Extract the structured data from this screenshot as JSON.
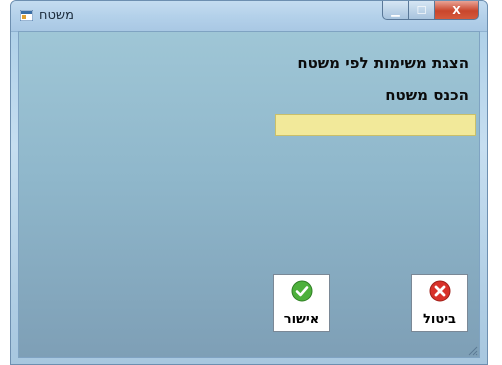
{
  "window": {
    "title": "משטח",
    "caption": {
      "minimize_glyph": "▁",
      "maximize_glyph": "☐",
      "close_glyph": "X"
    }
  },
  "form": {
    "heading": "הצגת משימות לפי משטח",
    "prompt": "הכנס משטח",
    "input_value": ""
  },
  "buttons": {
    "ok_label": "אישור",
    "cancel_label": "ביטול"
  },
  "icons": {
    "app": "form-icon",
    "ok": "green-check-icon",
    "cancel": "red-x-icon"
  },
  "colors": {
    "input_bg": "#f2e99a",
    "ok": "#4db03b",
    "cancel": "#d8322a"
  }
}
